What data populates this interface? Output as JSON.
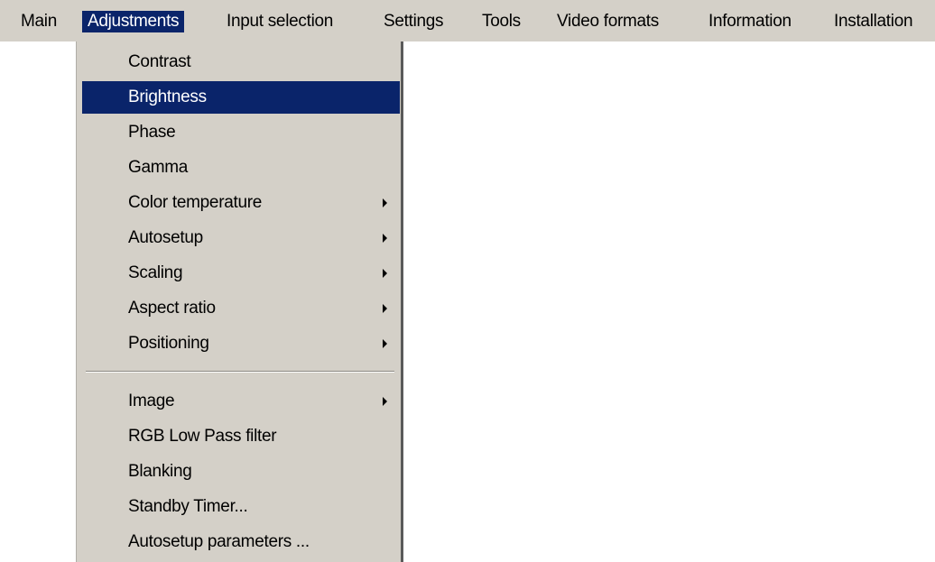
{
  "menubar": {
    "items": [
      {
        "label": "Main"
      },
      {
        "label": "Adjustments"
      },
      {
        "label": "Input selection"
      },
      {
        "label": "Settings"
      },
      {
        "label": "Tools"
      },
      {
        "label": "Video formats"
      },
      {
        "label": "Information"
      },
      {
        "label": "Installation"
      }
    ],
    "active_item": "Adjustments"
  },
  "dropdown": {
    "items": [
      {
        "label": "Contrast",
        "has_submenu": false
      },
      {
        "label": "Brightness",
        "has_submenu": false,
        "selected": true
      },
      {
        "label": "Phase",
        "has_submenu": false
      },
      {
        "label": "Gamma",
        "has_submenu": false
      },
      {
        "label": "Color temperature",
        "has_submenu": true
      },
      {
        "label": "Autosetup",
        "has_submenu": true
      },
      {
        "label": "Scaling",
        "has_submenu": true
      },
      {
        "label": "Aspect ratio",
        "has_submenu": true
      },
      {
        "label": "Positioning",
        "has_submenu": true
      },
      {
        "label": "Image",
        "has_submenu": true
      },
      {
        "label": "RGB Low Pass filter",
        "has_submenu": false
      },
      {
        "label": "Blanking",
        "has_submenu": false
      },
      {
        "label": "Standby Timer...",
        "has_submenu": false
      },
      {
        "label": "Autosetup parameters ...",
        "has_submenu": false
      }
    ]
  },
  "colors": {
    "menu_background": "#d4d0c8",
    "highlight": "#0a246a",
    "highlight_text": "#ffffff"
  }
}
